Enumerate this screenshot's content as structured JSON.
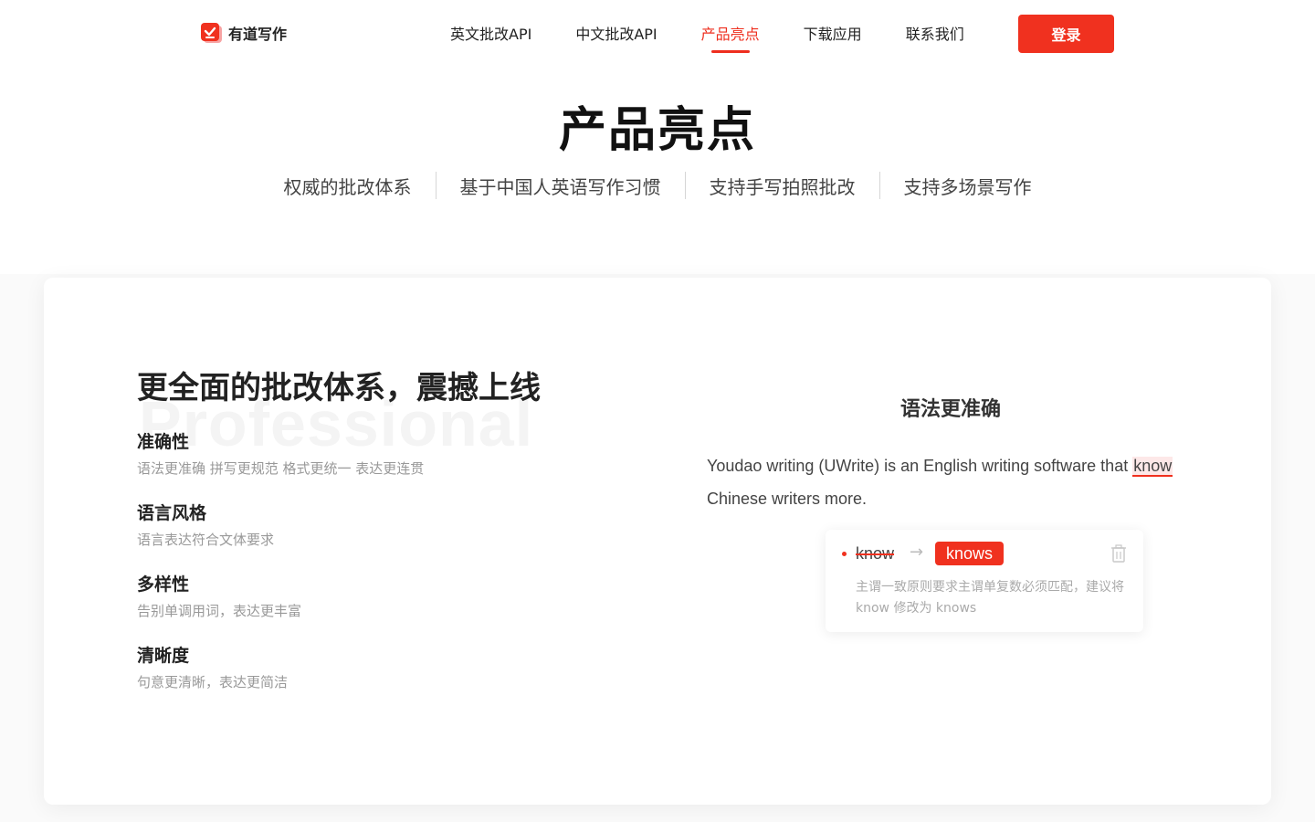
{
  "header": {
    "logo_text": "有道写作",
    "nav": [
      {
        "label": "英文批改API",
        "active": false
      },
      {
        "label": "中文批改API",
        "active": false
      },
      {
        "label": "产品亮点",
        "active": true
      },
      {
        "label": "下载应用",
        "active": false
      },
      {
        "label": "联系我们",
        "active": false
      }
    ],
    "login_label": "登录"
  },
  "section": {
    "title": "产品亮点",
    "tabs": [
      "权威的批改体系",
      "基于中国人英语写作习惯",
      "支持手写拍照批改",
      "支持多场景写作"
    ]
  },
  "card": {
    "title": "更全面的批改体系，震撼上线",
    "watermark": "Professional",
    "features": [
      {
        "name": "准确性",
        "desc": "语法更准确 拼写更规范 格式更统一 表达更连贯"
      },
      {
        "name": "语言风格",
        "desc": "语言表达符合文体要求"
      },
      {
        "name": "多样性",
        "desc": "告别单调用词，表达更丰富"
      },
      {
        "name": "清晰度",
        "desc": "句意更清晰，表达更简洁"
      }
    ],
    "demo": {
      "title": "语法更准确",
      "text_before": "Youdao writing (UWrite) is an English writing software that ",
      "error_word": "know",
      "text_after": " Chinese writers more.",
      "suggestion": {
        "wrong": "know",
        "arrow": "→",
        "right": "knows",
        "desc": "主谓一致原则要求主谓单复数必须匹配，建议将 know 修改为 knows"
      }
    }
  },
  "colors": {
    "accent": "#f0311f",
    "nav_active": "#ee2e1e"
  }
}
